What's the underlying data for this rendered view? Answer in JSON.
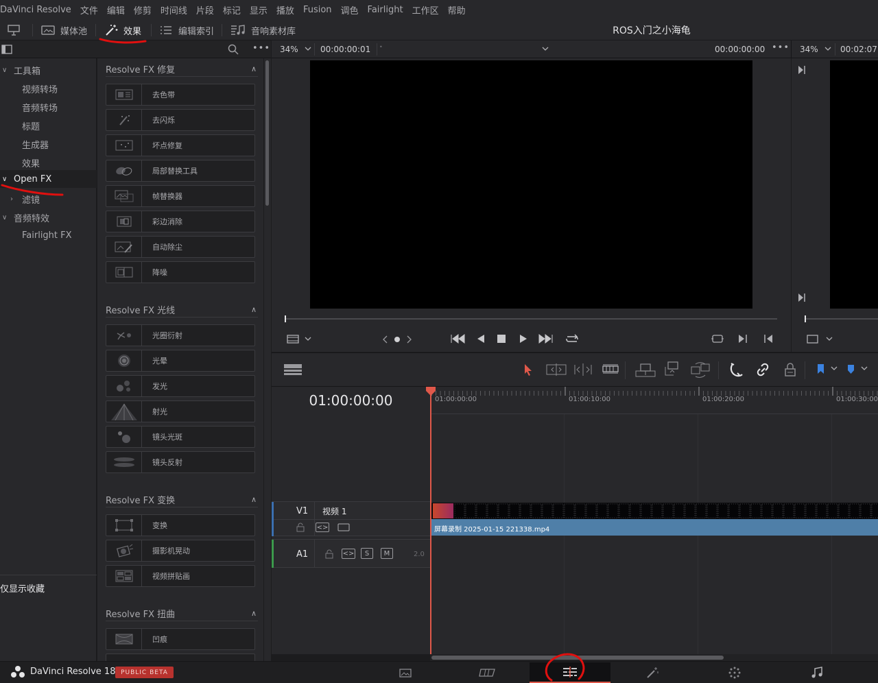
{
  "menubar": {
    "items": [
      "DaVinci Resolve",
      "文件",
      "编辑",
      "修剪",
      "时间线",
      "片段",
      "标记",
      "显示",
      "播放",
      "Fusion",
      "调色",
      "Fairlight",
      "工作区",
      "帮助"
    ]
  },
  "toolbar": {
    "media_pool": "媒体池",
    "effects": "效果",
    "edit_index": "编辑索引",
    "sound_library": "音响素材库",
    "project_title": "ROS入门之小海龟"
  },
  "sidebar": {
    "toolbox": "工具箱",
    "video_transitions": "视频转场",
    "audio_transitions": "音频转场",
    "titles": "标题",
    "generators": "生成器",
    "effects": "效果",
    "open_fx": "Open FX",
    "filters": "滤镜",
    "audio_fx": "音频特效",
    "fairlight_fx": "Fairlight FX",
    "favorites_only": "仅显示收藏"
  },
  "fx_sections": [
    {
      "title": "Resolve FX 修复",
      "items": [
        "去色带",
        "去闪烁",
        "坏点修复",
        "局部替换工具",
        "帧替换器",
        "彩边消除",
        "自动除尘",
        "降噪"
      ]
    },
    {
      "title": "Resolve FX 光线",
      "items": [
        "光圈衍射",
        "光晕",
        "发光",
        "射光",
        "镜头光斑",
        "镜头反射"
      ]
    },
    {
      "title": "Resolve FX 变换",
      "items": [
        "变换",
        "摄影机晃动",
        "视频拼贴画"
      ]
    },
    {
      "title": "Resolve FX 扭曲",
      "items": [
        "凹痕"
      ]
    }
  ],
  "viewer": {
    "zoom_left": "34%",
    "timecode_left": "00:00:00:01",
    "timecode_right": "00:00:00:00",
    "zoom_right": "34%",
    "timecode_far": "00:02:07:"
  },
  "timeline": {
    "timecode": "01:00:00:00",
    "ruler": [
      "01:00:00:00",
      "01:00:10:00",
      "01:00:20:00",
      "01:00:30:00"
    ],
    "v1_id": "V1",
    "v1_name": "视频 1",
    "a1_id": "A1",
    "a1_solo": "S",
    "a1_mute": "M",
    "a1_level": "2.0",
    "clip_name": "屏幕录制 2025-01-15 221338.mp4",
    "playhead_fraction": 0.0
  },
  "statusbar": {
    "app_name": "DaVinci Resolve 18",
    "badge": "PUBLIC BETA"
  },
  "colors": {
    "accent_red": "#e0584a",
    "clip_blue": "#4f7fa8",
    "annotation_red": "#e0100f"
  }
}
